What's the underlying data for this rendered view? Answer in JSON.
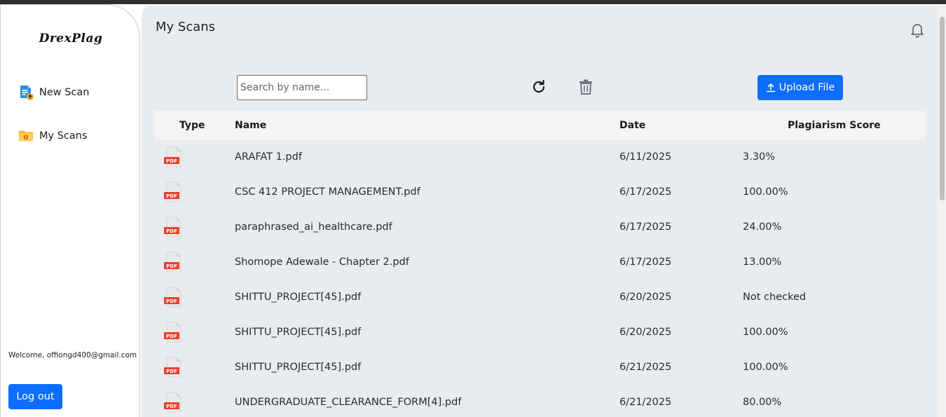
{
  "sidebar": {
    "logo": "DrexPlag",
    "items": [
      {
        "label": "New Scan",
        "icon": "new-scan-icon"
      },
      {
        "label": "My Scans",
        "icon": "folder-icon"
      }
    ],
    "welcome": "Welcome, offiongd400@gmail.com",
    "logout_label": "Log out"
  },
  "header": {
    "title": "My Scans"
  },
  "toolbar": {
    "search_placeholder": "Search by name...",
    "upload_label": "Upload File"
  },
  "table": {
    "columns": [
      "Type",
      "Name",
      "Date",
      "Plagiarism Score"
    ],
    "type_badge": "PDF",
    "rows": [
      {
        "name": "ARAFAT 1.pdf",
        "date": "6/11/2025",
        "score": "3.30%"
      },
      {
        "name": "CSC 412 PROJECT MANAGEMENT.pdf",
        "date": "6/17/2025",
        "score": "100.00%"
      },
      {
        "name": "paraphrased_ai_healthcare.pdf",
        "date": "6/17/2025",
        "score": "24.00%"
      },
      {
        "name": "Shomope Adewale - Chapter 2.pdf",
        "date": "6/17/2025",
        "score": "13.00%"
      },
      {
        "name": "SHITTU_PROJECT[45].pdf",
        "date": "6/20/2025",
        "score": "Not checked"
      },
      {
        "name": "SHITTU_PROJECT[45].pdf",
        "date": "6/20/2025",
        "score": "100.00%"
      },
      {
        "name": "SHITTU_PROJECT[45].pdf",
        "date": "6/21/2025",
        "score": "100.00%"
      },
      {
        "name": "UNDERGRADUATE_CLEARANCE_FORM[4].pdf",
        "date": "6/21/2025",
        "score": "80.00%"
      }
    ]
  },
  "colors": {
    "accent": "#0d6efd",
    "main_bg": "#e9ecef",
    "header_bg": "#f4f4f4",
    "pdf_red": "#e5432e"
  }
}
